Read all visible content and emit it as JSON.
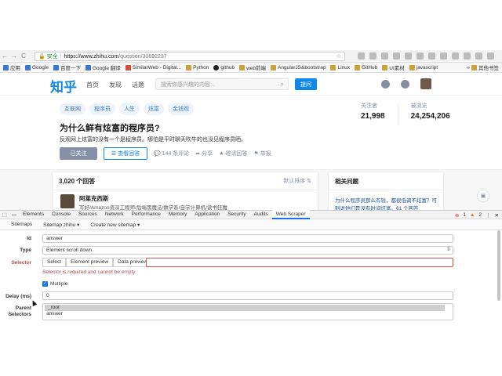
{
  "browser": {
    "nav": [
      "←",
      "→",
      "C"
    ],
    "secure_label": "安全",
    "url_host": "https://www.zhihu.com",
    "url_path": "/question/30692237",
    "bookmarks": [
      {
        "label": "应用",
        "icon": "apps-icon"
      },
      {
        "label": "Google",
        "icon": "google-icon"
      },
      {
        "label": "百度一下",
        "icon": "baidu-icon"
      },
      {
        "label": "Google 翻译",
        "icon": "translate-icon"
      },
      {
        "label": "SimilarWeb - Digital...",
        "icon": "similarweb-icon"
      },
      {
        "label": "Python",
        "icon": "folder-icon"
      },
      {
        "label": "github",
        "icon": "github-icon"
      },
      {
        "label": "web前端",
        "icon": "folder-icon"
      },
      {
        "label": "AngularJS&bootstrap",
        "icon": "folder-icon"
      },
      {
        "label": "Linux",
        "icon": "folder-icon"
      },
      {
        "label": "GitHub",
        "icon": "folder-icon"
      },
      {
        "label": "UI素材",
        "icon": "folder-icon"
      },
      {
        "label": "javascript",
        "icon": "folder-icon"
      }
    ],
    "bookmarks_more": "其他书签"
  },
  "zhihu": {
    "logo": "知乎",
    "nav": [
      "首页",
      "发现",
      "话题"
    ],
    "search_placeholder": "搜索你感兴趣的内容...",
    "ask_button": "提问",
    "tags": [
      "互联网",
      "程序员",
      "人生",
      "炫富",
      "金钱观"
    ],
    "title": "为什么鲜有炫富的程序员?",
    "description": "反观网上炫富的没有一个是程序员。哪怕是平时聊天吹牛的也没见程序员晒。",
    "follow_button": "已关注",
    "answer_button": "查看回答",
    "comments": "144 条评论",
    "share": "分享",
    "invite": "邀请回答",
    "report": "举报",
    "followers_label": "关注者",
    "followers": "21,998",
    "views_label": "被浏览",
    "views": "24,254,206",
    "answers_count": "3,020 个回答",
    "sort": "默认排序",
    "author_name": "阿莱克西斯",
    "author_bio": "写好/Amazon资深工程师/后端黑魔法/数学系/自学计算机/读书狂魔",
    "related_title": "相关问题",
    "related_link": "为什么程序员那么有钱，都很低调不炫富？可别说他们是没有时间炫富。61 个回答"
  },
  "devtools": {
    "tabs": [
      "Elements",
      "Console",
      "Sources",
      "Network",
      "Performance",
      "Memory",
      "Application",
      "Security",
      "Audits",
      "Web Scraper"
    ],
    "active_tab": "Web Scraper",
    "errors": "1",
    "warnings": "2",
    "scraper_menu": [
      "Sitemaps",
      "Sitemap zhihu ▾",
      "Create new sitemap ▾"
    ],
    "form": {
      "id_label": "Id",
      "id_value": "answer",
      "type_label": "Type",
      "type_value": "Element scroll down",
      "selector_label": "Selector",
      "select_btn": "Select",
      "element_preview_btn": "Element preview",
      "data_preview_btn": "Data preview",
      "selector_error": "Selector is required and cannot be empty",
      "multiple_label": "Multiple",
      "delay_label": "Delay (ms)",
      "delay_value": "0",
      "parent_label": "Parent\nSelectors",
      "parent_options": [
        "_root",
        "answer"
      ]
    }
  }
}
